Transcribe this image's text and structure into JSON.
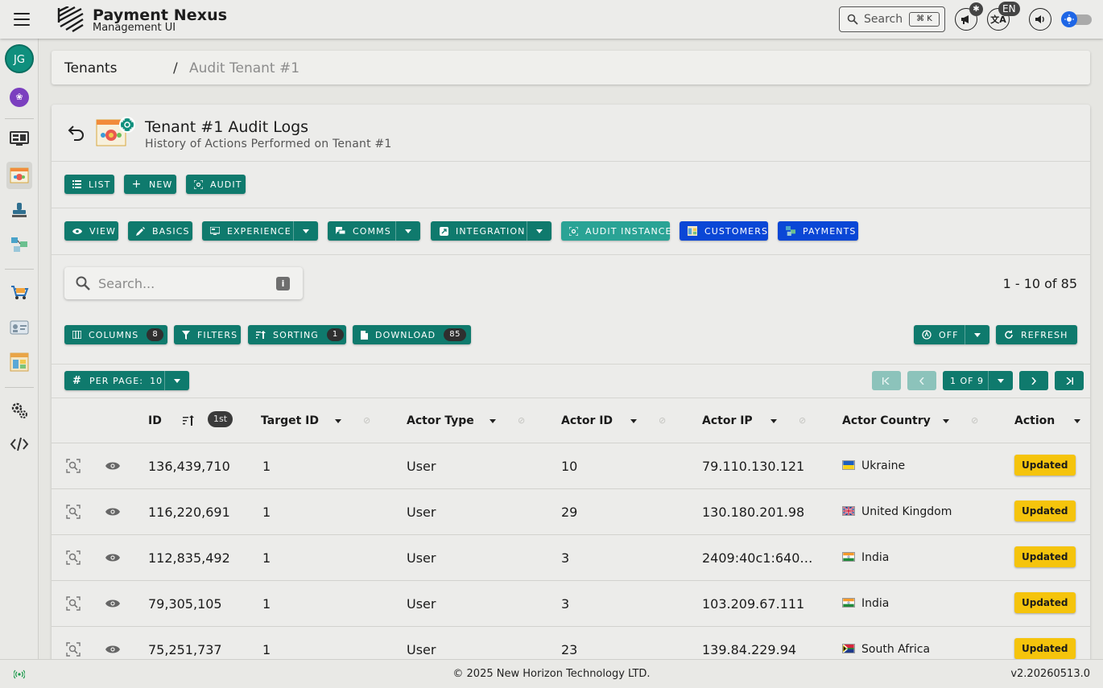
{
  "app": {
    "title": "Payment Nexus",
    "subtitle": "Management UI"
  },
  "topbar": {
    "search_label": "Search",
    "search_shortcut": "⌘ K",
    "notifications_badge": "✱",
    "language_badge": "EN",
    "icons": [
      "menu-icon",
      "search-icon",
      "announcement-icon",
      "translate-icon",
      "volume-icon",
      "theme-toggle-icon"
    ]
  },
  "sidebar": {
    "avatar_initials": "JG",
    "org_initial": "❀",
    "items": [
      "dashboard-icon",
      "tenants-icon",
      "stamp-icon",
      "integrations-icon",
      "store-cart-icon",
      "id-card-icon",
      "catalog-icon",
      "settings-icon",
      "code-icon"
    ]
  },
  "breadcrumb": {
    "root": "Tenants",
    "separator": "/",
    "current": "Audit Tenant #1"
  },
  "header": {
    "title": "Tenant #1 Audit Logs",
    "subtitle": "History of Actions Performed on Tenant #1"
  },
  "actions": {
    "list": "LIST",
    "new": "NEW",
    "audit": "AUDIT"
  },
  "nav": {
    "view": "VIEW",
    "basics": "BASICS",
    "experience": "EXPERIENCE",
    "comms": "COMMS",
    "integration": "INTEGRATION",
    "audit_instance": "AUDIT INSTANCE",
    "customers": "CUSTOMERS",
    "payments": "PAYMENTS"
  },
  "table_search": {
    "placeholder": "Search...",
    "info": "i"
  },
  "range": "1 - 10 of 85",
  "toolbar": {
    "columns": "COLUMNS",
    "columns_count": "8",
    "filters": "FILTERS",
    "sorting": "SORTING",
    "sorting_count": "1",
    "download": "DOWNLOAD",
    "download_count": "85",
    "auto_refresh": "OFF",
    "refresh": "REFRESH"
  },
  "pagination": {
    "per_page_label": "PER PAGE:",
    "per_page_value": "10",
    "page_indicator": "1 OF 9"
  },
  "columns": {
    "id": "ID",
    "sort_order": "1st",
    "target_id": "Target ID",
    "actor_type": "Actor Type",
    "actor_id": "Actor ID",
    "actor_ip": "Actor IP",
    "actor_country": "Actor Country",
    "action": "Action"
  },
  "rows": [
    {
      "id": "136,439,710",
      "target_id": "1",
      "actor_type": "User",
      "actor_id": "10",
      "actor_ip": "79.110.130.121",
      "country": "Ukraine",
      "flag": "ua",
      "action": "Updated"
    },
    {
      "id": "116,220,691",
      "target_id": "1",
      "actor_type": "User",
      "actor_id": "29",
      "actor_ip": "130.180.201.98",
      "country": "United Kingdom",
      "flag": "gb",
      "action": "Updated"
    },
    {
      "id": "112,835,492",
      "target_id": "1",
      "actor_type": "User",
      "actor_id": "3",
      "actor_ip": "2409:40c1:640…",
      "country": "India",
      "flag": "in",
      "action": "Updated"
    },
    {
      "id": "79,305,105",
      "target_id": "1",
      "actor_type": "User",
      "actor_id": "3",
      "actor_ip": "103.209.67.111",
      "country": "India",
      "flag": "in",
      "action": "Updated"
    },
    {
      "id": "75,251,737",
      "target_id": "1",
      "actor_type": "User",
      "actor_id": "23",
      "actor_ip": "139.84.229.94",
      "country": "South Africa",
      "flag": "za",
      "action": "Updated"
    }
  ],
  "footer": {
    "copyright": "© 2025 New Horizon Technology LTD.",
    "version": "v2.20260513.0"
  },
  "colors": {
    "primary": "#0f7a6d",
    "primary_light": "#2aa395",
    "blue": "#0a47d6",
    "status_updated": "#f5c40c"
  }
}
